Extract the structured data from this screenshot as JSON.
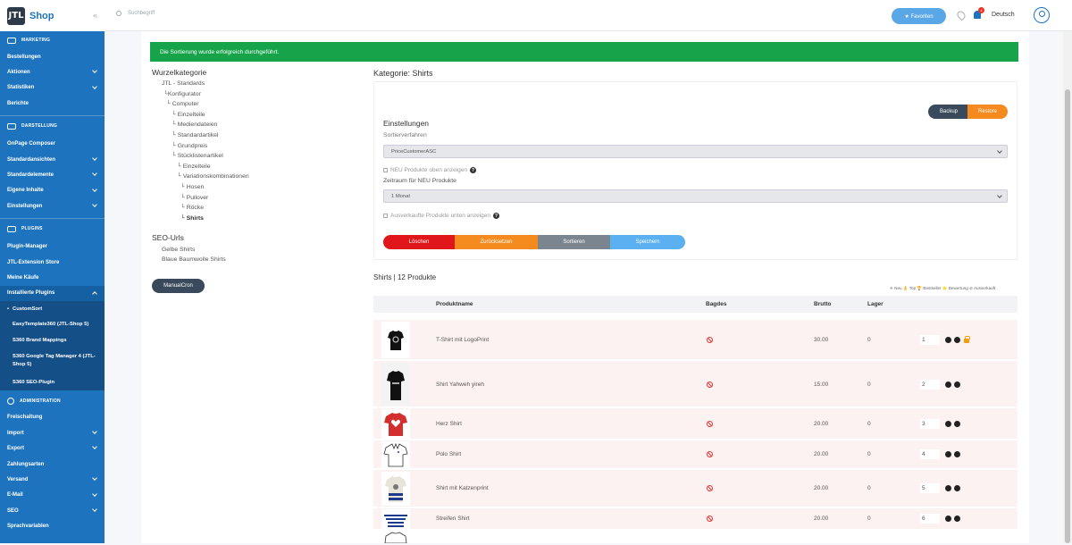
{
  "app": {
    "logo": "JTL",
    "brand": "Shop",
    "collapse": "«"
  },
  "topbar": {
    "search_placeholder": "Suchbegriff",
    "favorites": "★ Favoriten",
    "notification_count": "4",
    "language": "Deutsch"
  },
  "sidebar": {
    "marketing": "MARKETING",
    "bestellungen": "Bestellungen",
    "aktionen": "Aktionen",
    "statistiken": "Statistiken",
    "berichte": "Berichte",
    "darstellung": "DARSTELLUNG",
    "onpage": "OnPage Composer",
    "standardansichten": "Standardansichten",
    "standardelemente": "Standardelemente",
    "eigene_inhalte": "Eigene Inhalte",
    "einstellungen": "Einstellungen",
    "plugins": "PLUGINS",
    "plugin_manager": "Plugin-Manager",
    "extension_store": "JTL-Extension Store",
    "meine_kaeufe": "Meine Käufe",
    "installierte_plugins": "Installierte Plugins",
    "sub_customsort": "CustomSort",
    "sub_easytemplate": "EasyTemplate360 (JTL-Shop 5)",
    "sub_brand": "S360 Brand Mappings",
    "sub_gtm": "S360 Google Tag Manager 4 (JTL-Shop 5)",
    "sub_seo": "S360 SEO-Plugin",
    "administration": "ADMINISTRATION",
    "freischaltung": "Freischaltung",
    "import": "Import",
    "export": "Export",
    "zahlungsarten": "Zahlungsarten",
    "versand": "Versand",
    "email": "E-Mail",
    "seo": "SEO",
    "sprachvariablen": "Sprachvariablen"
  },
  "alert": "Die Sortierung wurde erfolgreich durchgeführt.",
  "tree": {
    "title": "Wurzelkategorie",
    "items": [
      "JTL - Standards",
      "└Konfigurator",
      "└ Computer",
      "└ Einzelteile",
      "└ Mediendateien",
      "└ Standardartikel",
      "└ Grundpreis",
      "└ Stücklistenartikel",
      "└ Einzelteile",
      "└ Variationskombinationen",
      "└ Hosen",
      "└ Pullover",
      "└ Röcke",
      "└ Shirts"
    ]
  },
  "seo": {
    "title": "SEO-Urls",
    "links": [
      "Gelbe Shirts",
      "Blaue Baumwolle Shirts"
    ]
  },
  "manualcron": "ManualCron",
  "category": {
    "title": "Kategorie: Shirts"
  },
  "settings": {
    "backup": "Backup",
    "restore": "Restore",
    "title": "Einstellungen",
    "sort_label": "Sortierverfahren",
    "sort_value": "PriceCustomerASC",
    "new_top": "NEU Produkte oben anzeigen",
    "period_label": "Zeitraum für NEU Produkte",
    "period_value": "1 Monat",
    "soldout_bottom": "Ausverkaufte Produkte unten anzeigen",
    "delete": "Löschen",
    "reset": "Zurücksetzen",
    "sort": "Sortieren",
    "save": "Speichern"
  },
  "products": {
    "title": "Shirts | 12 Produkte",
    "legend": "✳ Neu 👌 Top 🏆 Bestseller ⭐ Bewertung ⊘ Ausverkauft",
    "headers": {
      "name": "Produktname",
      "badges": "Bagdes",
      "brutto": "Brutto",
      "lager": "Lager"
    },
    "rows": [
      {
        "name": "T-Shirt mit LogoPrint",
        "price": "30.00",
        "stock": "0",
        "pos": "1",
        "locked": true
      },
      {
        "name": "Shirt Yahweh yireh",
        "price": "15.00",
        "stock": "0",
        "pos": "2"
      },
      {
        "name": "Herz Shirt",
        "price": "20.00",
        "stock": "0",
        "pos": "3"
      },
      {
        "name": "Polo Shirt",
        "price": "20.00",
        "stock": "0",
        "pos": "4"
      },
      {
        "name": "Shirt mit Katzenprint",
        "price": "20.00",
        "stock": "0",
        "pos": "5"
      },
      {
        "name": "Streifen Shirt",
        "price": "20.00",
        "stock": "0",
        "pos": "6"
      }
    ]
  },
  "colors": {
    "sidebar": "#1e73be",
    "success": "#16a34a",
    "danger": "#e0161b",
    "warning": "#f58a1f",
    "secondary": "#7a858f",
    "info": "#5ab0f0"
  }
}
